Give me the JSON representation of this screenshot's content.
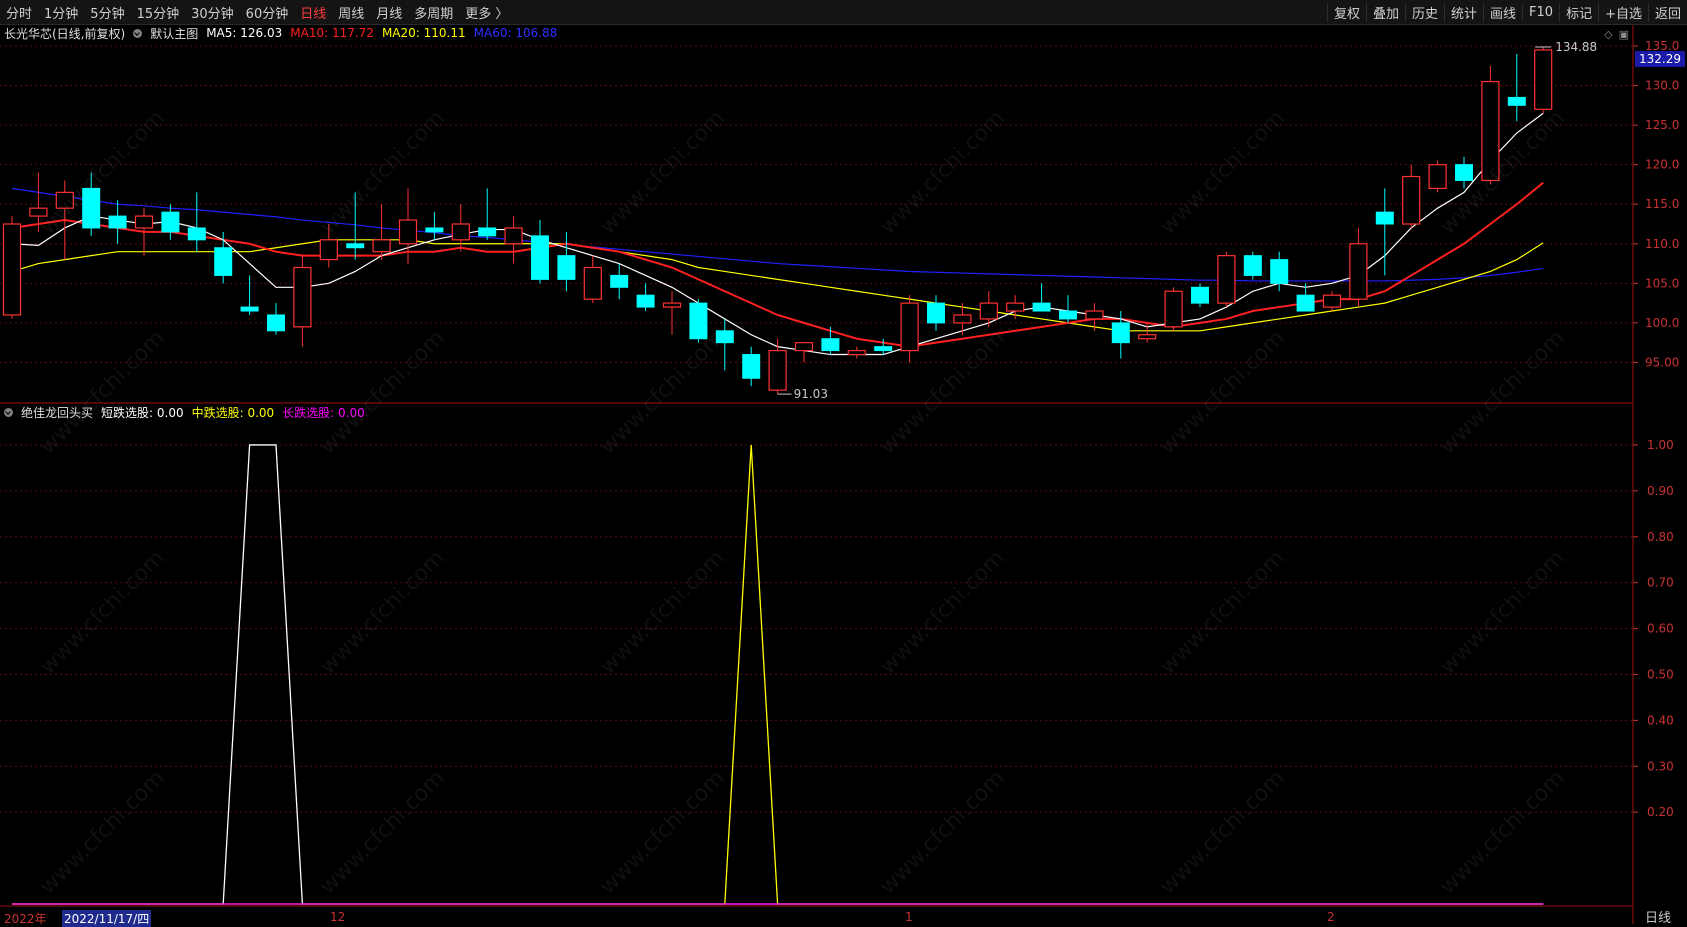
{
  "toolbar": {
    "left_items": [
      "分时",
      "1分钟",
      "5分钟",
      "15分钟",
      "30分钟",
      "60分钟",
      "日线",
      "周线",
      "月线",
      "多周期",
      "更多 〉"
    ],
    "active": "日线",
    "right_items": [
      "复权",
      "叠加",
      "历史",
      "统计",
      "画线",
      "F10",
      "标记",
      "+自选",
      "返回"
    ]
  },
  "main_info": {
    "stock": "长光华芯(日线,前复权)",
    "template": "默认主图",
    "ma5": "MA5: 126.03",
    "ma10": "MA10: 117.72",
    "ma20": "MA20: 110.11",
    "ma60": "MA60: 106.88"
  },
  "indicator_info": {
    "name": "绝佳龙回头买",
    "short": "短跌选股: 0.00",
    "mid": "中跌选股: 0.00",
    "long": "长跌选股: 0.00"
  },
  "current_price": "132.29",
  "annotations": {
    "high": "134.88",
    "low": "91.03"
  },
  "dates": {
    "year": "2022年",
    "current": "2022/11/17/四",
    "m12": "12",
    "m1": "1",
    "m2": "2"
  },
  "period_tab": "日线",
  "watermark_text": "www.cfchi.com",
  "colors": {
    "up": "#ff3232",
    "down": "#00ffff",
    "ma5": "#ffffff",
    "ma10": "#ff2020",
    "ma20": "#ffff00",
    "ma60": "#2020ff",
    "short": "#ffffff",
    "mid": "#ffff00",
    "long": "#ff00ff"
  },
  "chart_data": [
    {
      "type": "candlestick",
      "ylim": [
        90,
        135
      ],
      "yticks": [
        95,
        100,
        105,
        110,
        115,
        120,
        125,
        130,
        135
      ],
      "ytick_labels": [
        "95.00",
        "100.0",
        "105.0",
        "110.0",
        "115.0",
        "120.0",
        "125.0",
        "130.0",
        "135.0"
      ],
      "candles": [
        {
          "o": 101.0,
          "h": 113.5,
          "l": 100.5,
          "c": 112.5
        },
        {
          "o": 113.5,
          "h": 119.0,
          "l": 111.5,
          "c": 114.5
        },
        {
          "o": 114.5,
          "h": 118.0,
          "l": 108.0,
          "c": 116.5
        },
        {
          "o": 117.0,
          "h": 119.0,
          "l": 111.0,
          "c": 112.0
        },
        {
          "o": 113.5,
          "h": 115.5,
          "l": 110.0,
          "c": 112.0
        },
        {
          "o": 112.0,
          "h": 114.5,
          "l": 108.5,
          "c": 113.5
        },
        {
          "o": 114.0,
          "h": 115.0,
          "l": 110.5,
          "c": 111.5
        },
        {
          "o": 112.0,
          "h": 116.5,
          "l": 109.0,
          "c": 110.5
        },
        {
          "o": 109.5,
          "h": 111.5,
          "l": 105.0,
          "c": 106.0
        },
        {
          "o": 102.0,
          "h": 106.0,
          "l": 101.0,
          "c": 101.5
        },
        {
          "o": 101.0,
          "h": 102.5,
          "l": 98.5,
          "c": 99.0
        },
        {
          "o": 99.5,
          "h": 108.5,
          "l": 97.0,
          "c": 107.0
        },
        {
          "o": 108.0,
          "h": 112.5,
          "l": 107.0,
          "c": 110.5
        },
        {
          "o": 110.0,
          "h": 116.5,
          "l": 108.0,
          "c": 109.5
        },
        {
          "o": 109.0,
          "h": 115.0,
          "l": 108.0,
          "c": 110.5
        },
        {
          "o": 110.0,
          "h": 117.0,
          "l": 107.5,
          "c": 113.0
        },
        {
          "o": 112.0,
          "h": 114.0,
          "l": 110.5,
          "c": 111.5
        },
        {
          "o": 110.5,
          "h": 115.0,
          "l": 109.0,
          "c": 112.5
        },
        {
          "o": 112.0,
          "h": 117.0,
          "l": 110.5,
          "c": 111.0
        },
        {
          "o": 110.0,
          "h": 113.5,
          "l": 107.5,
          "c": 112.0
        },
        {
          "o": 111.0,
          "h": 113.0,
          "l": 105.0,
          "c": 105.5
        },
        {
          "o": 108.5,
          "h": 111.5,
          "l": 104.0,
          "c": 105.5
        },
        {
          "o": 103.0,
          "h": 108.5,
          "l": 102.5,
          "c": 107.0
        },
        {
          "o": 106.0,
          "h": 107.5,
          "l": 103.0,
          "c": 104.5
        },
        {
          "o": 103.5,
          "h": 105.0,
          "l": 101.5,
          "c": 102.0
        },
        {
          "o": 102.0,
          "h": 104.0,
          "l": 98.5,
          "c": 102.5
        },
        {
          "o": 102.5,
          "h": 103.0,
          "l": 97.5,
          "c": 98.0
        },
        {
          "o": 99.0,
          "h": 100.5,
          "l": 94.0,
          "c": 97.5
        },
        {
          "o": 96.0,
          "h": 97.0,
          "l": 92.0,
          "c": 93.0
        },
        {
          "o": 91.5,
          "h": 98.0,
          "l": 91.0,
          "c": 96.5
        },
        {
          "o": 96.5,
          "h": 97.5,
          "l": 95.0,
          "c": 97.5
        },
        {
          "o": 98.0,
          "h": 99.5,
          "l": 96.0,
          "c": 96.5
        },
        {
          "o": 96.0,
          "h": 97.0,
          "l": 95.5,
          "c": 96.5
        },
        {
          "o": 97.0,
          "h": 98.0,
          "l": 96.0,
          "c": 96.5
        },
        {
          "o": 96.5,
          "h": 103.5,
          "l": 95.0,
          "c": 102.5
        },
        {
          "o": 102.5,
          "h": 103.5,
          "l": 99.0,
          "c": 100.0
        },
        {
          "o": 100.0,
          "h": 102.5,
          "l": 98.5,
          "c": 101.0
        },
        {
          "o": 100.5,
          "h": 104.0,
          "l": 99.5,
          "c": 102.5
        },
        {
          "o": 101.5,
          "h": 103.5,
          "l": 100.5,
          "c": 102.5
        },
        {
          "o": 102.5,
          "h": 105.0,
          "l": 101.5,
          "c": 101.5
        },
        {
          "o": 101.5,
          "h": 103.5,
          "l": 100.0,
          "c": 100.5
        },
        {
          "o": 100.5,
          "h": 102.5,
          "l": 99.0,
          "c": 101.5
        },
        {
          "o": 100.0,
          "h": 101.5,
          "l": 95.5,
          "c": 97.5
        },
        {
          "o": 98.0,
          "h": 100.0,
          "l": 97.5,
          "c": 98.5
        },
        {
          "o": 99.5,
          "h": 104.5,
          "l": 99.0,
          "c": 104.0
        },
        {
          "o": 104.5,
          "h": 105.0,
          "l": 102.0,
          "c": 102.5
        },
        {
          "o": 102.5,
          "h": 109.0,
          "l": 102.0,
          "c": 108.5
        },
        {
          "o": 108.5,
          "h": 109.0,
          "l": 105.5,
          "c": 106.0
        },
        {
          "o": 108.0,
          "h": 109.0,
          "l": 104.0,
          "c": 105.0
        },
        {
          "o": 103.5,
          "h": 105.0,
          "l": 101.5,
          "c": 101.5
        },
        {
          "o": 102.0,
          "h": 104.0,
          "l": 101.5,
          "c": 103.5
        },
        {
          "o": 103.0,
          "h": 112.0,
          "l": 102.0,
          "c": 110.0
        },
        {
          "o": 114.0,
          "h": 117.0,
          "l": 106.0,
          "c": 112.5
        },
        {
          "o": 112.5,
          "h": 120.0,
          "l": 112.0,
          "c": 118.5
        },
        {
          "o": 117.0,
          "h": 120.5,
          "l": 116.5,
          "c": 120.0
        },
        {
          "o": 120.0,
          "h": 121.0,
          "l": 117.0,
          "c": 118.0
        },
        {
          "o": 118.0,
          "h": 132.5,
          "l": 117.5,
          "c": 130.5
        },
        {
          "o": 128.5,
          "h": 134.0,
          "l": 125.5,
          "c": 127.5
        },
        {
          "o": 127.0,
          "h": 134.88,
          "l": 126.5,
          "c": 134.5
        }
      ],
      "ma5": [
        110.0,
        109.8,
        112.0,
        113.5,
        113.0,
        112.5,
        112.8,
        112.0,
        110.5,
        107.5,
        104.5,
        104.5,
        105.0,
        106.5,
        108.5,
        109.5,
        110.5,
        111.2,
        111.8,
        111.8,
        110.5,
        109.5,
        108.5,
        107.5,
        106.0,
        104.5,
        102.5,
        100.5,
        98.5,
        97.0,
        96.5,
        96.0,
        96.0,
        96.0,
        97.0,
        98.0,
        99.0,
        100.0,
        101.5,
        102.0,
        101.5,
        101.0,
        100.5,
        99.5,
        100.0,
        100.5,
        102.0,
        104.0,
        105.0,
        104.5,
        105.0,
        106.0,
        108.5,
        112.0,
        114.5,
        116.5,
        120.5,
        124.0,
        126.5
      ],
      "ma10": [
        112.0,
        112.5,
        113.0,
        112.5,
        112.0,
        111.5,
        111.5,
        111.0,
        110.5,
        110.0,
        109.0,
        108.5,
        108.5,
        108.5,
        108.5,
        109.0,
        109.0,
        109.5,
        109.0,
        109.0,
        109.5,
        110.0,
        109.5,
        109.0,
        108.0,
        107.0,
        105.5,
        104.0,
        102.5,
        101.0,
        100.0,
        99.0,
        98.0,
        97.5,
        97.0,
        97.5,
        98.0,
        98.5,
        99.0,
        99.5,
        100.0,
        100.5,
        100.5,
        100.0,
        99.5,
        100.0,
        100.5,
        101.5,
        102.0,
        102.5,
        103.0,
        103.0,
        104.0,
        106.0,
        108.0,
        110.0,
        112.5,
        115.0,
        117.72
      ],
      "ma20": [
        106.5,
        107.5,
        108.0,
        108.5,
        109.0,
        109.0,
        109.0,
        109.0,
        109.0,
        109.0,
        109.5,
        110.0,
        110.5,
        110.5,
        110.5,
        110.5,
        110.0,
        110.0,
        110.0,
        110.0,
        110.0,
        110.0,
        109.5,
        109.0,
        108.5,
        108.0,
        107.0,
        106.5,
        106.0,
        105.5,
        105.0,
        104.5,
        104.0,
        103.5,
        103.0,
        102.5,
        102.0,
        101.5,
        101.0,
        100.5,
        100.0,
        99.5,
        99.0,
        99.0,
        99.0,
        99.0,
        99.5,
        100.0,
        100.5,
        101.0,
        101.5,
        102.0,
        102.5,
        103.5,
        104.5,
        105.5,
        106.5,
        108.0,
        110.11
      ],
      "ma60": [
        117.0,
        116.5,
        116.0,
        115.5,
        115.0,
        114.8,
        114.5,
        114.3,
        114.0,
        113.7,
        113.4,
        113.0,
        112.7,
        112.4,
        112.0,
        111.7,
        111.4,
        111.0,
        110.8,
        110.5,
        110.2,
        109.9,
        109.6,
        109.3,
        109.0,
        108.7,
        108.4,
        108.1,
        107.8,
        107.5,
        107.3,
        107.1,
        106.9,
        106.7,
        106.5,
        106.4,
        106.3,
        106.2,
        106.1,
        106.0,
        105.9,
        105.8,
        105.7,
        105.6,
        105.5,
        105.4,
        105.4,
        105.3,
        105.3,
        105.3,
        105.3,
        105.3,
        105.3,
        105.4,
        105.5,
        105.7,
        106.0,
        106.4,
        106.88
      ]
    },
    {
      "type": "line",
      "ylim": [
        0,
        1.05
      ],
      "yticks": [
        0.2,
        0.3,
        0.4,
        0.5,
        0.6,
        0.7,
        0.8,
        0.9,
        1.0
      ],
      "ytick_labels": [
        "0.20",
        "0.30",
        "0.40",
        "0.50",
        "0.60",
        "0.70",
        "0.80",
        "0.90",
        "1.00"
      ],
      "series": [
        {
          "name": "短跌选股",
          "values": [
            0,
            0,
            0,
            0,
            0,
            0,
            0,
            0,
            0,
            1,
            1,
            0,
            0,
            0,
            0,
            0,
            0,
            0,
            0,
            0,
            0,
            0,
            0,
            0,
            0,
            0,
            0,
            0,
            0,
            0,
            0,
            0,
            0,
            0,
            0,
            0,
            0,
            0,
            0,
            0,
            0,
            0,
            0,
            0,
            0,
            0,
            0,
            0,
            0,
            0,
            0,
            0,
            0,
            0,
            0,
            0,
            0,
            0,
            0
          ]
        },
        {
          "name": "中跌选股",
          "values": [
            0,
            0,
            0,
            0,
            0,
            0,
            0,
            0,
            0,
            0,
            0,
            0,
            0,
            0,
            0,
            0,
            0,
            0,
            0,
            0,
            0,
            0,
            0,
            0,
            0,
            0,
            0,
            0,
            1,
            0,
            0,
            0,
            0,
            0,
            0,
            0,
            0,
            0,
            0,
            0,
            0,
            0,
            0,
            0,
            0,
            0,
            0,
            0,
            0,
            0,
            0,
            0,
            0,
            0,
            0,
            0,
            0,
            0,
            0
          ]
        },
        {
          "name": "长跌选股",
          "values": [
            0,
            0,
            0,
            0,
            0,
            0,
            0,
            0,
            0,
            0,
            0,
            0,
            0,
            0,
            0,
            0,
            0,
            0,
            0,
            0,
            0,
            0,
            0,
            0,
            0,
            0,
            0,
            0,
            0,
            0,
            0,
            0,
            0,
            0,
            0,
            0,
            0,
            0,
            0,
            0,
            0,
            0,
            0,
            0,
            0,
            0,
            0,
            0,
            0,
            0,
            0,
            0,
            0,
            0,
            0,
            0,
            0,
            0,
            0
          ]
        }
      ]
    }
  ]
}
